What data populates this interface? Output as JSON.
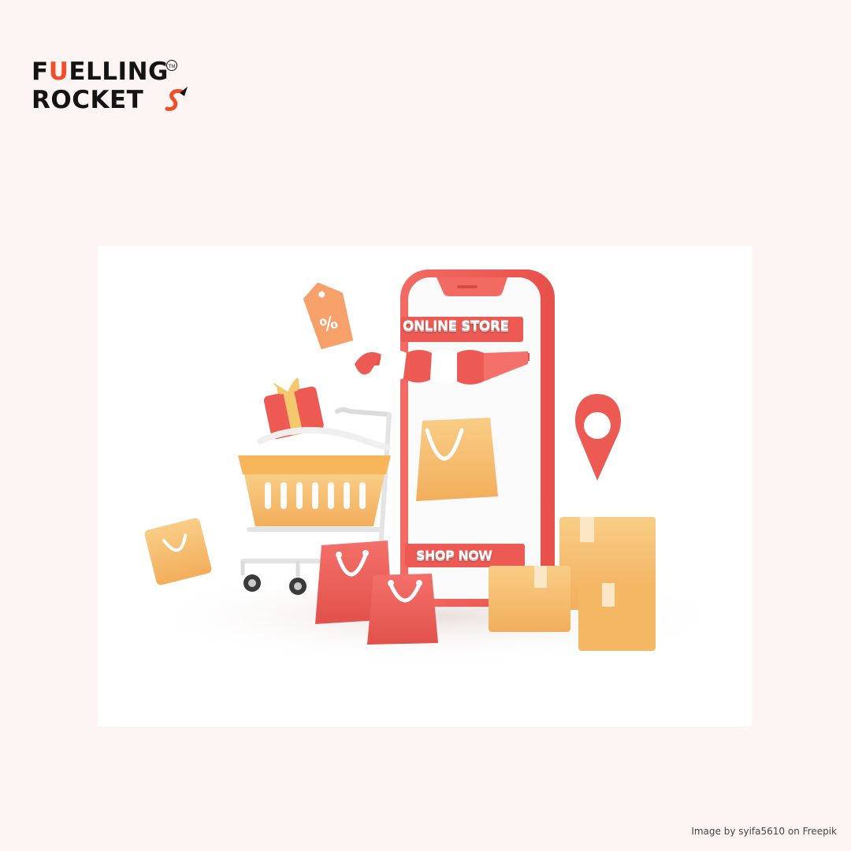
{
  "logo": {
    "line1_pre": "F",
    "line1_u": "U",
    "line1_post": "ELLING",
    "line2": "ROCKET",
    "trademark": "TM"
  },
  "illustration": {
    "sign_text": "ONLINE STORE",
    "button_text": "SHOP NOW",
    "tag_symbol": "%"
  },
  "credit": "Image by syifa5610 on Freepik",
  "colors": {
    "background": "#fdf5f3",
    "brand_orange": "#f04e2a",
    "coral": "#f2655d",
    "amber": "#f7c072"
  }
}
